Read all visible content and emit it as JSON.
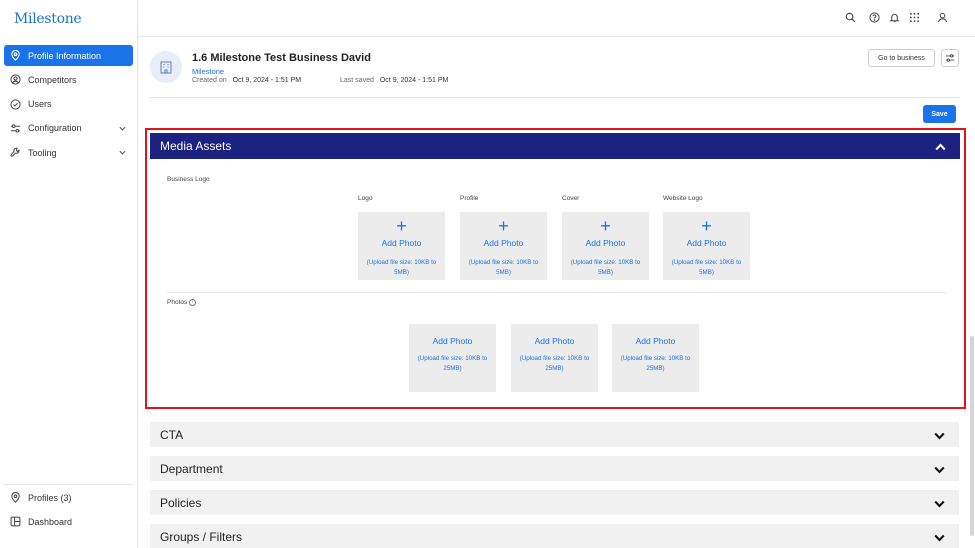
{
  "app": {
    "logo": "Milestone"
  },
  "sidebar": {
    "items": [
      {
        "label": "Profile Information",
        "icon": "map-pin-icon",
        "active": true
      },
      {
        "label": "Competitors",
        "icon": "user-circle-icon"
      },
      {
        "label": "Users",
        "icon": "check-circle-icon"
      },
      {
        "label": "Configuration",
        "icon": "sliders-icon",
        "expandable": true
      },
      {
        "label": "Tooling",
        "icon": "wrench-icon",
        "expandable": true
      }
    ],
    "bottom_items": [
      {
        "label": "Profiles (3)",
        "icon": "map-pin-icon"
      },
      {
        "label": "Dashboard",
        "icon": "dashboard-icon"
      }
    ]
  },
  "topbar": {
    "icons": [
      "search-icon",
      "help-icon",
      "bell-icon",
      "apps-grid-icon",
      "user-icon"
    ]
  },
  "business": {
    "title": "1.6 Milestone Test Business David",
    "link": "Milestone",
    "created_label": "Created on",
    "created_value": "Oct 9, 2024 - 1:51 PM",
    "saved_label": "Last saved",
    "saved_value": "Oct 9, 2024 - 1:51 PM"
  },
  "actions": {
    "go_to_business": "Go to business",
    "save": "Save"
  },
  "media_assets": {
    "title": "Media Assets",
    "business_logo_label": "Business Logo",
    "slots": [
      {
        "label": "Logo",
        "add": "Add Photo",
        "size": "(Upload file size: 10KB to 5MB)"
      },
      {
        "label": "Profile",
        "add": "Add Photo",
        "size": "(Upload file size: 10KB to 5MB)"
      },
      {
        "label": "Cover",
        "add": "Add Photo",
        "size": "(Upload file size: 10KB to 5MB)"
      },
      {
        "label": "Website Logo",
        "add": "Add Photo",
        "size": "(Upload file size: 10KB to 5MB)"
      }
    ],
    "photos_label": "Photos",
    "photos": [
      {
        "add": "Add Photo",
        "size": "(Upload file size: 10KB to 25MB)"
      },
      {
        "add": "Add Photo",
        "size": "(Upload file size: 10KB to 25MB)"
      },
      {
        "add": "Add Photo",
        "size": "(Upload file size: 10KB to 25MB)"
      }
    ]
  },
  "sections": [
    {
      "title": "CTA"
    },
    {
      "title": "Department"
    },
    {
      "title": "Policies"
    },
    {
      "title": "Groups / Filters"
    }
  ],
  "colors": {
    "primary": "#1a73e8",
    "media_header": "#1c2280",
    "highlight": "#e0151b"
  }
}
